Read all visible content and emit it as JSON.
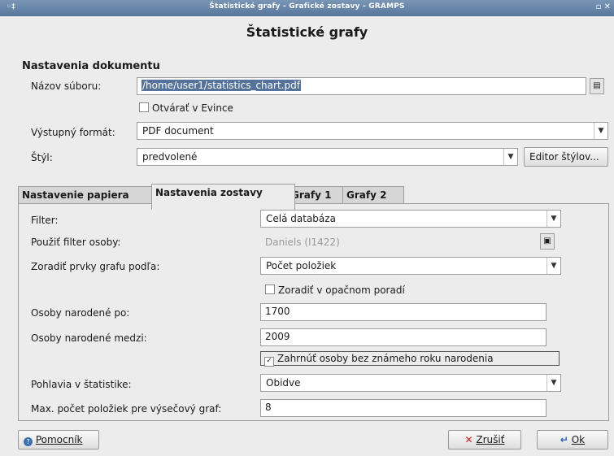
{
  "window": {
    "title": "Štatistické grafy - Grafické zostavy - GRAMPS",
    "heading": "Štatistické grafy"
  },
  "document": {
    "section_title": "Nastavenia dokumentu",
    "filename_label": "Názov súboru:",
    "filename_value": "/home/user1/statistics_chart.pdf",
    "open_evince_label": "Otvárať v Evince",
    "open_evince_checked": false,
    "output_format_label": "Výstupný formát:",
    "output_format_value": "PDF document",
    "style_label": "Štýl:",
    "style_value": "predvolené",
    "style_editor_button": "Editor štýlov..."
  },
  "tabs": [
    {
      "label": "Nastavenie papiera",
      "active": false
    },
    {
      "label": "Nastavenia zostavy",
      "active": true
    },
    {
      "label": "Grafy 1",
      "active": false
    },
    {
      "label": "Grafy 2",
      "active": false
    }
  ],
  "report_options": {
    "filter_label": "Filter:",
    "filter_value": "Celá databáza",
    "person_filter_label": "Použiť filter osoby:",
    "person_filter_value": "Daniels (I1422)",
    "sort_label": "Zoradiť prvky grafu podľa:",
    "sort_value": "Počet položiek",
    "reverse_sort_label": "Zoradiť v opačnom poradí",
    "reverse_sort_checked": false,
    "born_after_label": "Osoby narodené po:",
    "born_after_value": "1700",
    "born_between_label": "Osoby narodené medzi:",
    "born_between_value": "2009",
    "include_unknown_label": "Zahrnúť osoby bez známeho roku narodenia",
    "include_unknown_checked": true,
    "gender_label": "Pohlavia v štatistike:",
    "gender_value": "Obidve",
    "max_items_label": "Max. počet položiek pre výsečový graf:",
    "max_items_value": "8"
  },
  "footer": {
    "help_button": "Pomocník",
    "cancel_button": "Zrušiť",
    "ok_button": "Ok"
  },
  "colors": {
    "titlebar": "#56769c",
    "selection": "#55739a",
    "cancel_icon": "#d31b1b",
    "help_icon": "#3a6fb0",
    "ok_icon": "#2d64b0"
  }
}
